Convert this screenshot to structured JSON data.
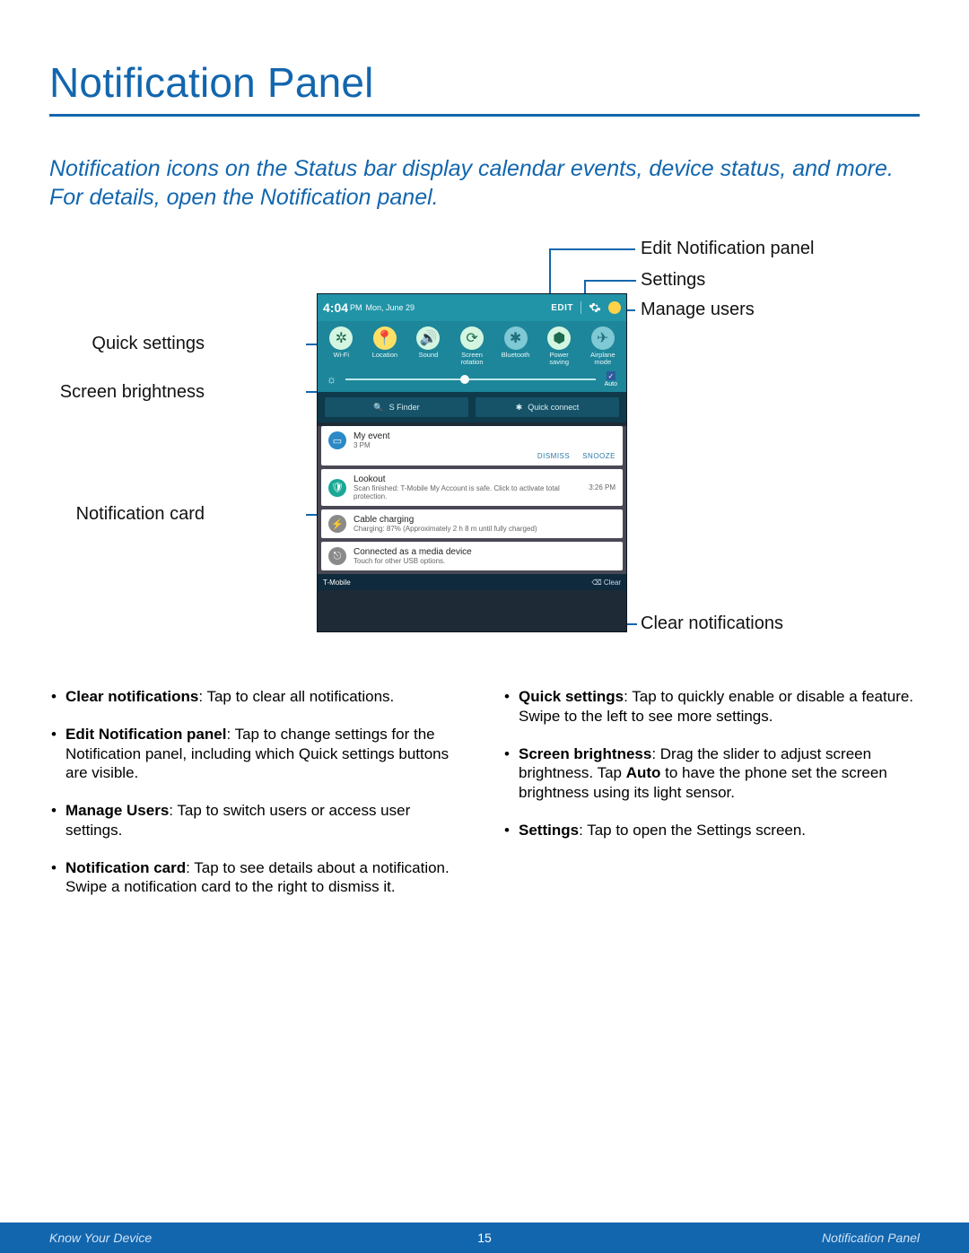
{
  "title": "Notification Panel",
  "intro": "Notification icons on the Status bar display calendar events, device status, and more. For details, open the Notification panel.",
  "callouts": {
    "edit": "Edit Notification panel",
    "settings": "Settings",
    "manage_users": "Manage users",
    "quick_settings": "Quick settings",
    "screen_brightness": "Screen brightness",
    "notification_card": "Notification card",
    "clear_notifications": "Clear notifications"
  },
  "phone": {
    "status": {
      "time": "4:04",
      "ampm": "PM",
      "date": "Mon, June 29",
      "edit": "EDIT"
    },
    "qs": [
      {
        "label": "Wi-Fi",
        "glyph": "✲",
        "cls": "on"
      },
      {
        "label": "Location",
        "glyph": "📍",
        "cls": "ylw"
      },
      {
        "label": "Sound",
        "glyph": "🔊",
        "cls": "on"
      },
      {
        "label": "Screen\nrotation",
        "glyph": "⟳",
        "cls": "on"
      },
      {
        "label": "Bluetooth",
        "glyph": "✱",
        "cls": "off"
      },
      {
        "label": "Power\nsaving",
        "glyph": "⬢",
        "cls": "on"
      },
      {
        "label": "Airplane\nmode",
        "glyph": "✈",
        "cls": "off"
      }
    ],
    "brightness": {
      "auto_label": "Auto"
    },
    "sfinder": "S Finder",
    "quick_connect": "Quick connect",
    "cards": [
      {
        "title": "My event",
        "sub": "3 PM",
        "right": "",
        "actions": [
          "DISMISS",
          "SNOOZE"
        ],
        "color": "#2b89c6",
        "glyph": "▭"
      },
      {
        "title": "Lookout",
        "sub": "Scan finished: T-Mobile My Account is safe. Click to activate total protection.",
        "right": "3:26 PM",
        "color": "#1aa896",
        "glyph": "🛡"
      },
      {
        "title": "Cable charging",
        "sub": "Charging: 87% (Approximately 2 h 8 m until fully charged)",
        "right": "",
        "color": "#8a8a8a",
        "glyph": "⚡"
      },
      {
        "title": "Connected as a media device",
        "sub": "Touch for other USB options.",
        "right": "",
        "color": "#8a8a8a",
        "glyph": "⎋"
      }
    ],
    "carrier": "T-Mobile",
    "clear": "Clear",
    "clear_glyph": "⌫"
  },
  "bullets": {
    "left": [
      {
        "term": "Clear notifications",
        "text": ": Tap to clear all notifications."
      },
      {
        "term": "Edit Notification panel",
        "text": ": Tap to change settings for the Notification panel, including which Quick settings buttons are visible."
      },
      {
        "term": "Manage Users",
        "text": ": Tap to switch users or access user settings."
      },
      {
        "term": "Notification card",
        "text": ": Tap to see details about a notification. Swipe a notification card to the right to dismiss it."
      }
    ],
    "right": [
      {
        "term": "Quick settings",
        "text": ": Tap to quickly enable or disable a feature. Swipe to the left to see more settings."
      },
      {
        "term": "Screen brightness",
        "text1": ": Drag the slider to adjust screen brightness. Tap ",
        "term2": "Auto",
        "text2": " to have the phone set the screen brightness using its light sensor."
      },
      {
        "term": "Settings",
        "text": ": Tap to open the Settings screen."
      }
    ]
  },
  "footer": {
    "left": "Know Your Device",
    "page": "15",
    "right": "Notification Panel"
  }
}
